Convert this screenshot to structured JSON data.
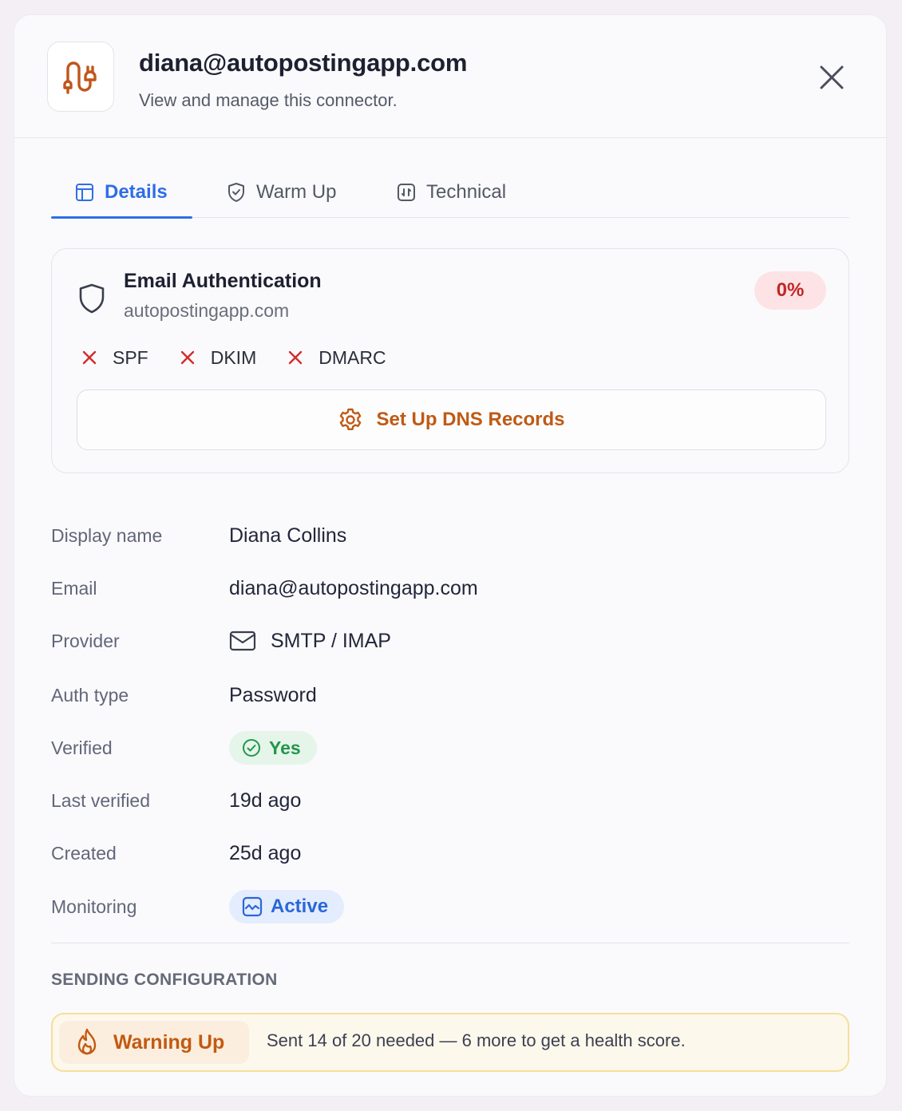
{
  "header": {
    "title": "diana@autopostingapp.com",
    "subtitle": "View and manage this connector."
  },
  "tabs": [
    {
      "label": "Details",
      "icon": "layout-icon",
      "active": true
    },
    {
      "label": "Warm Up",
      "icon": "shield-check-icon",
      "active": false
    },
    {
      "label": "Technical",
      "icon": "code-icon",
      "active": false
    }
  ],
  "auth": {
    "title": "Email Authentication",
    "domain": "autopostingapp.com",
    "score": "0%",
    "checks": [
      {
        "label": "SPF",
        "status": "fail"
      },
      {
        "label": "DKIM",
        "status": "fail"
      },
      {
        "label": "DMARC",
        "status": "fail"
      }
    ],
    "setup_button": "Set Up DNS Records"
  },
  "details": {
    "display_name": {
      "label": "Display name",
      "value": "Diana Collins"
    },
    "email": {
      "label": "Email",
      "value": "diana@autopostingapp.com"
    },
    "provider": {
      "label": "Provider",
      "value": "SMTP / IMAP"
    },
    "auth_type": {
      "label": "Auth type",
      "value": "Password"
    },
    "verified": {
      "label": "Verified",
      "value": "Yes"
    },
    "last_verified": {
      "label": "Last verified",
      "value": "19d ago"
    },
    "created": {
      "label": "Created",
      "value": "25d ago"
    },
    "monitoring": {
      "label": "Monitoring",
      "value": "Active"
    }
  },
  "sending": {
    "section_title": "SENDING CONFIGURATION",
    "status_label": "Warning Up",
    "status_text": "Sent 14 of 20 needed — 6 more to get a health score."
  },
  "colors": {
    "accent_blue": "#2f6ee6",
    "brand_orange": "#c05a15",
    "error_red": "#c22626",
    "success_green": "#23964a"
  }
}
